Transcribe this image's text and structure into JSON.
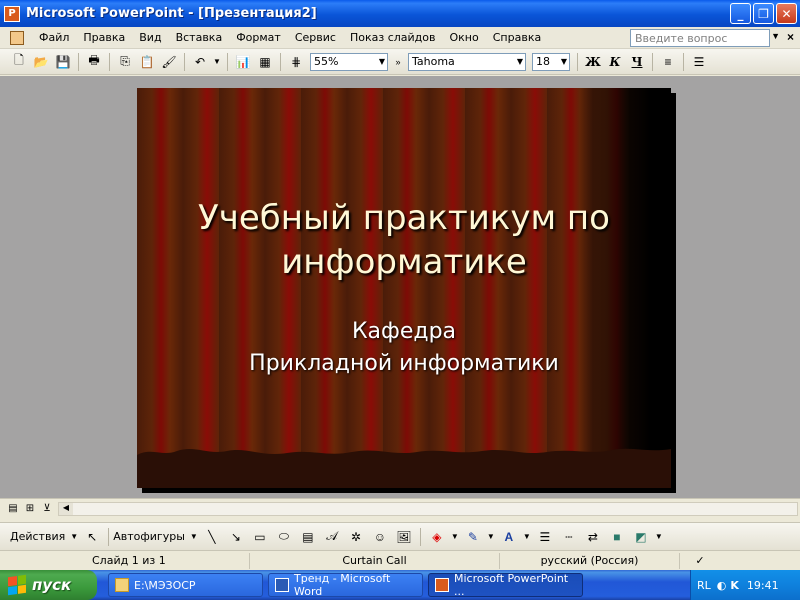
{
  "window": {
    "title": "Microsoft PowerPoint - [Презентация2]",
    "app_icon_glyph": "P",
    "minimize_glyph": "_",
    "restore_glyph": "❐",
    "close_glyph": "✕"
  },
  "menu": {
    "items": [
      "Файл",
      "Правка",
      "Вид",
      "Вставка",
      "Формат",
      "Сервис",
      "Показ слайдов",
      "Окно",
      "Справка"
    ],
    "help_placeholder": "Введите вопрос",
    "close_glyph": "×"
  },
  "toolbar": {
    "zoom": "55%",
    "font": "Tahoma",
    "font_size": "18",
    "bold": "Ж",
    "italic": "К",
    "underline": "Ч"
  },
  "slide": {
    "title_line1": "Учебный практикум по",
    "title_line2": "информатике",
    "subtitle_line1": "Кафедра",
    "subtitle_line2": "Прикладной информатики"
  },
  "drawing": {
    "actions_label": "Действия",
    "autoshapes_label": "Автофигуры"
  },
  "status": {
    "slide_counter": "Слайд 1 из 1",
    "design": "Curtain Call",
    "language": "русский (Россия)"
  },
  "taskbar": {
    "start_label": "пуск",
    "tasks": [
      "E:\\МЭЗОСР",
      "Тренд - Microsoft Word",
      "Microsoft PowerPoint ..."
    ],
    "lang": "RL",
    "time": "19:41"
  },
  "colors": {
    "title_bar": "#0A55D8",
    "slide_title": "#FFF8D6",
    "curtain_red": "#7E0A06",
    "start_green": "#3B9A3C"
  }
}
